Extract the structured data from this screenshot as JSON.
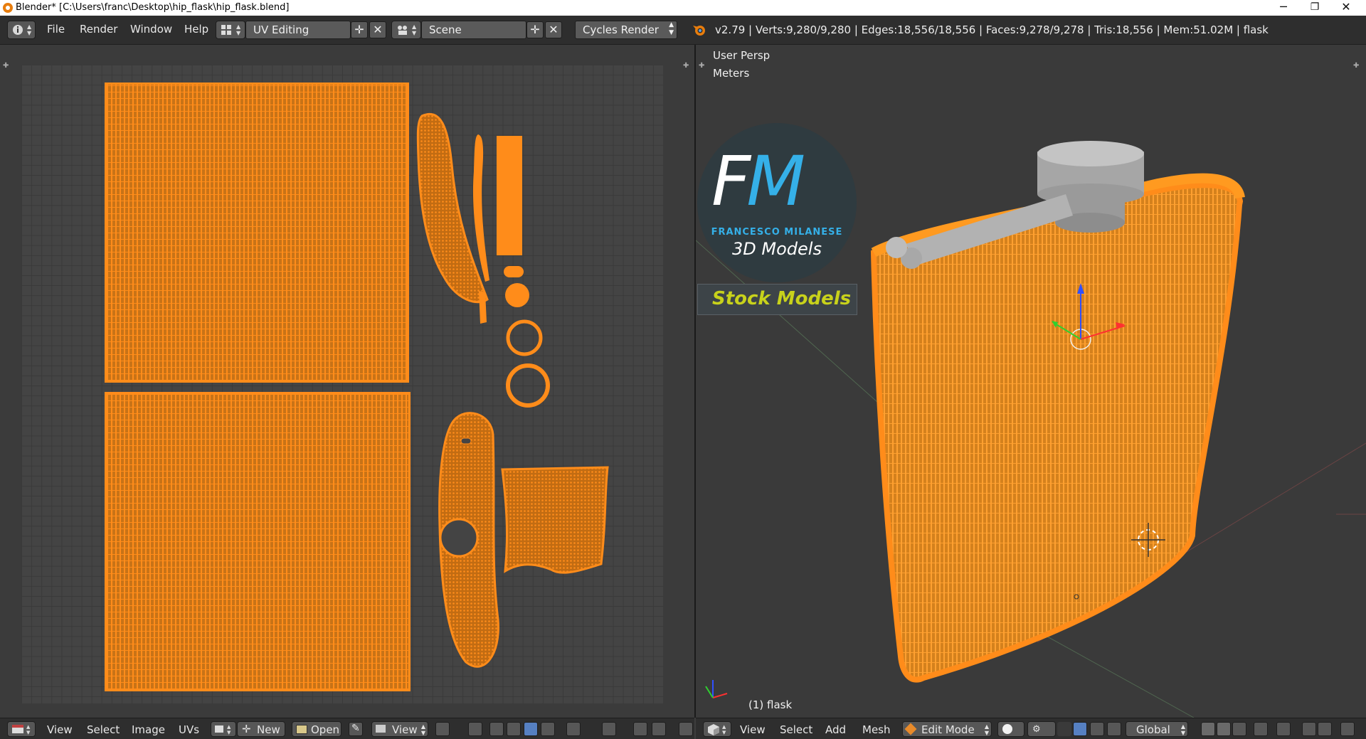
{
  "window": {
    "title": "Blender* [C:\\Users\\franc\\Desktop\\hip_flask\\hip_flask.blend]",
    "minimize": "─",
    "restore": "❐",
    "close": "✕"
  },
  "header": {
    "menus": [
      "File",
      "Render",
      "Window",
      "Help"
    ],
    "screen_layout": "UV Editing",
    "scene": "Scene",
    "render_engine": "Cycles Render",
    "stats": "v2.79 | Verts:9,280/9,280 | Edges:18,556/18,556 | Faces:9,278/9,278 | Tris:18,556 | Mem:51.02M | flask"
  },
  "uv_editor": {
    "menus": [
      "View",
      "Select",
      "Image",
      "UVs"
    ],
    "new_label": "New",
    "open_label": "Open",
    "view_label": "View"
  },
  "viewport": {
    "view_name": "User Persp",
    "units": "Meters",
    "object_label": "(1) flask",
    "menus": [
      "View",
      "Select",
      "Add",
      "Mesh"
    ],
    "mode": "Edit Mode",
    "orientation": "Global"
  },
  "watermark": {
    "letters_f": "F",
    "letters_m": "M",
    "name": "FRANCESCO MILANESE",
    "tagline": "3D Models",
    "stock": "Stock Models"
  },
  "colors": {
    "accent_orange": "#ff8c1a",
    "logo_blue": "#35b0e8",
    "stock_yellow": "#c8d21b"
  }
}
